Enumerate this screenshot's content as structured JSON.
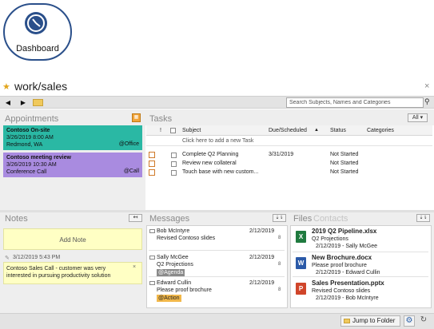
{
  "badge": {
    "label": "Dashboard",
    "icon": "clock-icon"
  },
  "header": {
    "title": "work/sales",
    "star_icon": "star-icon",
    "close": "×"
  },
  "toolbar": {
    "back": "◀",
    "forward": "▶",
    "search_placeholder": "Search Subjects, Names and Categories"
  },
  "appointments": {
    "title": "Appointments",
    "items": [
      {
        "title": "Contoso On-site",
        "when": "3/26/2019 8:00 AM",
        "where": "Redmond, WA",
        "tag": "@Office",
        "color": "#2ab8a4"
      },
      {
        "title": "Contoso meeting review",
        "when": "3/26/2019 10:30 AM",
        "where": "Conference Call",
        "tag": "@Call",
        "color": "#a98be0"
      }
    ]
  },
  "tasks": {
    "title": "Tasks",
    "filter": "All",
    "columns": {
      "priority": "!",
      "subject": "Subject",
      "due": "Due/Scheduled",
      "sort": "▲",
      "status": "Status",
      "categories": "Categories"
    },
    "add_prompt": "Click here to add a new Task",
    "rows": [
      {
        "subject": "Complete Q2 Planning",
        "due": "3/31/2019",
        "status": "Not Started"
      },
      {
        "subject": "Review new collateral",
        "due": "",
        "status": "Not Started"
      },
      {
        "subject": "Touch base with new custom...",
        "due": "",
        "status": "Not Started"
      }
    ]
  },
  "notes": {
    "title": "Notes",
    "add_label": "Add Note",
    "meta": "3/12/2019 5:43 PM",
    "note_text": "Contoso Sales Call - customer was very interested in pursuing productivity solution",
    "close": "×"
  },
  "messages": {
    "title": "Messages",
    "items": [
      {
        "from": "Bob McIntyre",
        "date": "2/12/2019",
        "subject": "Revised Contoso slides",
        "page": "8",
        "tag": ""
      },
      {
        "from": "Sally McGee",
        "date": "2/12/2019",
        "subject": "Q2 Projections",
        "page": "8",
        "tag": "@Agenda",
        "tag_color": "#8a8a8a"
      },
      {
        "from": "Edward Cullin",
        "date": "2/12/2019",
        "subject": "Please proof brochure",
        "page": "8",
        "tag": "@Action",
        "tag_color": "#f2b84a"
      }
    ]
  },
  "files": {
    "title": "Files",
    "contacts_title": "Contacts",
    "items": [
      {
        "name": "2019 Q2 Pipeline.xlsx",
        "subject": "Q2 Projections",
        "meta": "2/12/2019 - Sally McGee",
        "icon_letter": "X",
        "icon_color": "#1f7a3f"
      },
      {
        "name": "New Brochure.docx",
        "subject": "Please proof brochure",
        "meta": "2/12/2019 - Edward Cullin",
        "icon_letter": "W",
        "icon_color": "#2b5aa8"
      },
      {
        "name": "Sales Presentation.pptx",
        "subject": "Revised Contoso slides",
        "meta": "2/12/2019 - Bob McIntyre",
        "icon_letter": "P",
        "icon_color": "#d0452a"
      }
    ]
  },
  "footer": {
    "jump_label": "Jump to Folder"
  }
}
